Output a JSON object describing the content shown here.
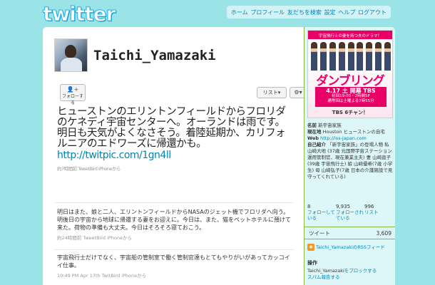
{
  "header": {
    "logo": "twitter",
    "nav": [
      "ホーム",
      "プロフィール",
      "友だちを検索",
      "設定",
      "ヘルプ",
      "ログアウト"
    ]
  },
  "profile": {
    "screen_name": "Taichi_Yamazaki",
    "follow_label": "フォローする",
    "list_label": "リスト▾",
    "settings_label": "⚙▾"
  },
  "featured_tweet": {
    "text": "ヒューストンのエリントンフィールドからフロリダのケネディ宇宙センターへ。オーランドは雨です。明日も天気がよくなさそう。着陸延期か、カリフォルニアのエドワーズに帰還かも。",
    "link": "http://twitpic.com/1gn4ll",
    "meta": "約7時間前 TweetBird iPhoneから"
  },
  "tweets": [
    {
      "text": "明日はまた、娘と二人、エリントンフィールドからNASAのジェット機でフロリダへ向う。明後日の宇宙から地球に帰還する妻をお迎えに。今日は、また、猫をペットホテルに預けて来た。荷物の準備も大丈夫。今日はそろそろ寝ておこう。",
      "meta": "約24時間前 TweetBird iPhoneから"
    },
    {
      "text": "宇宙飛行士だけでなく、宇宙船の管制室で働く管制官達もとてもやりがいがあってカッコイイ仕事。",
      "meta": "10:49 PM Apr 17th TwitBird iPhoneから"
    }
  ],
  "sidebar": {
    "banner": {
      "tagline": "宇宙飛行士の妻を持つ夫のドラマ！",
      "title": "ダンブリング",
      "air_date": "4.17 土 開幕 TBS",
      "schedule_1": "初回19:00・2時間SP",
      "schedule_2": "通常回は土曜よる7時55分",
      "network": "TBS 6チャン！"
    },
    "name_label": "名前",
    "name_value": "新宇宙家族",
    "location_label": "現在地",
    "location_value": "Houston ヒューストンの自宅",
    "web_label": "Web",
    "web_value": "http://iss-japan.com",
    "bio_label": "自己紹介",
    "bio_value": "「新宇宙家族」の登場人物 私 山崎大地 (37歳 元国際宇宙ステーション運用管制官、現在兼業主夫) 妻 山崎直子(39歳 宇宙飛行士) 娘 山崎優希(7歳 小学生) 母 山崎弘子(7歳 日本の介護施設で見守ってくれている)",
    "stats": [
      {
        "count": "8",
        "label": "フォローしている"
      },
      {
        "count": "9,935",
        "label": "フォローされている"
      },
      {
        "count": "996",
        "label": "リスト"
      }
    ],
    "tweets_label": "ツイート",
    "tweets_count": "3,609",
    "rss_label": "Taichi_YamazakiのRSSフィード",
    "ops_title": "操作",
    "ops_user": "Taichi_Yamazaki",
    "ops_text": "をブロックする",
    "ops_report": "スパム報告する"
  }
}
